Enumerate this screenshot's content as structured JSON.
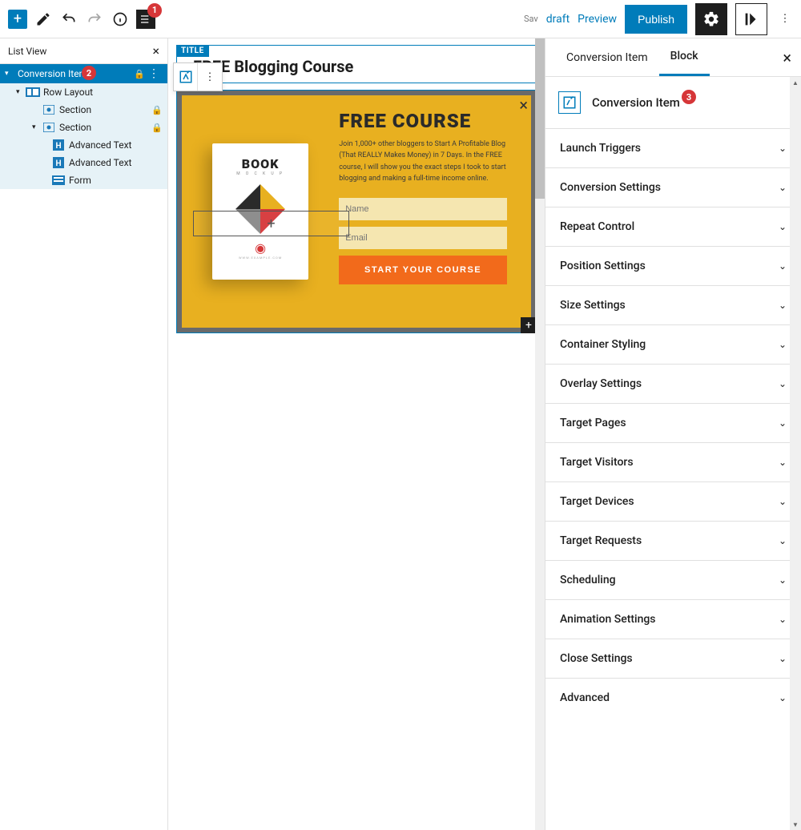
{
  "toolbar": {
    "save_hint": "Sav",
    "draft": "draft",
    "preview": "Preview",
    "publish": "Publish"
  },
  "badges": {
    "b1": "1",
    "b2": "2",
    "b3": "3"
  },
  "listview": {
    "title": "List View",
    "items": [
      {
        "label": "Conversion Item",
        "selected": true,
        "locked": true,
        "indent": 0,
        "chev": true,
        "icon": "conv"
      },
      {
        "label": "Row Layout",
        "indent": 1,
        "chev": true,
        "icon": "row"
      },
      {
        "label": "Section",
        "indent": 2,
        "chev": false,
        "icon": "sec",
        "locked": true
      },
      {
        "label": "Section",
        "indent": 2,
        "chev": true,
        "icon": "sec",
        "locked": true
      },
      {
        "label": "Advanced Text",
        "indent": 3,
        "icon": "h"
      },
      {
        "label": "Advanced Text",
        "indent": 3,
        "icon": "h"
      },
      {
        "label": "Form",
        "indent": 3,
        "icon": "form"
      }
    ]
  },
  "block": {
    "title_badge": "TITLE",
    "heading": "FREE Blogging Course",
    "popup": {
      "headline": "FREE COURSE",
      "desc": "Join 1,000+ other bloggers to Start A Profitable Blog (That REALLY Makes Money) in 7 Days. In the FREE course, I will show you the exact steps I took to start blogging and making a full-time income online.",
      "name_ph": "Name",
      "email_ph": "Email",
      "cta": "START YOUR COURSE",
      "book_title": "BOOK",
      "book_sub": "M O C K U P"
    }
  },
  "sidebar": {
    "tab1": "Conversion Item",
    "tab2": "Block",
    "block_name": "Conversion Item",
    "panels": [
      "Launch Triggers",
      "Conversion Settings",
      "Repeat Control",
      "Position Settings",
      "Size Settings",
      "Container Styling",
      "Overlay Settings",
      "Target Pages",
      "Target Visitors",
      "Target Devices",
      "Target Requests",
      "Scheduling",
      "Animation Settings",
      "Close Settings",
      "Advanced"
    ]
  }
}
